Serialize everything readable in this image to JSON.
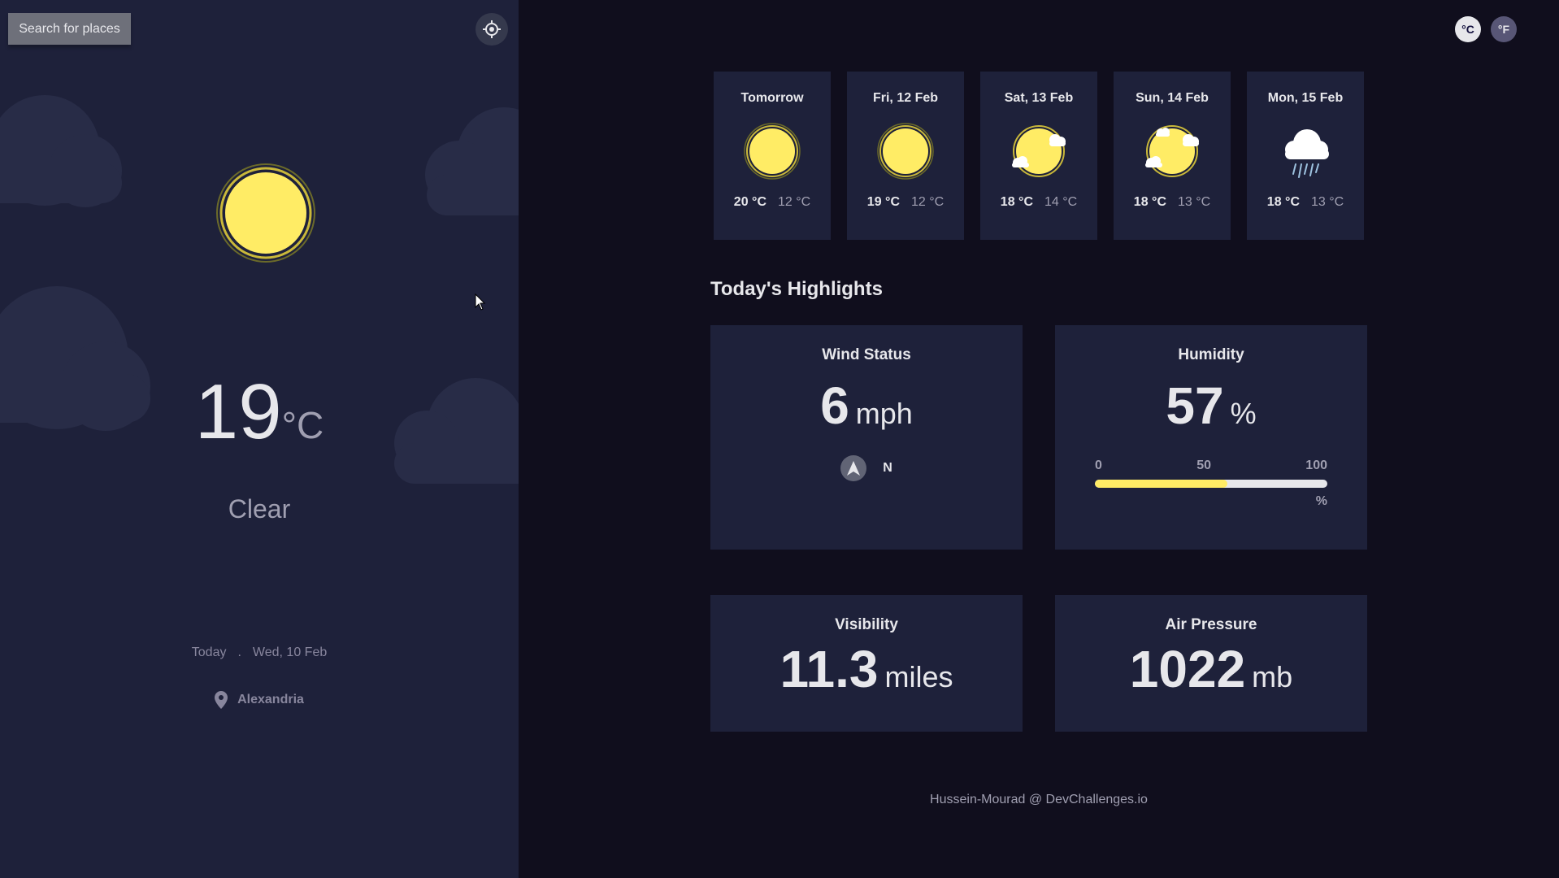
{
  "search": {
    "label": "Search for places"
  },
  "current": {
    "temp": "19",
    "unit": "°C",
    "condition": "Clear",
    "today_label": "Today",
    "separator": ".",
    "date": "Wed, 10 Feb",
    "location": "Alexandria",
    "icon": "sun-icon"
  },
  "units": {
    "celsius": "°C",
    "fahrenheit": "°F",
    "active": "celsius"
  },
  "forecast": [
    {
      "day": "Tomorrow",
      "max": "20 °C",
      "min": "12 °C",
      "icon": "sun-icon"
    },
    {
      "day": "Fri, 12 Feb",
      "max": "19 °C",
      "min": "12 °C",
      "icon": "sun-icon"
    },
    {
      "day": "Sat, 13 Feb",
      "max": "18 °C",
      "min": "14 °C",
      "icon": "sun-clouds-icon"
    },
    {
      "day": "Sun, 14 Feb",
      "max": "18 °C",
      "min": "13 °C",
      "icon": "sun-clouds-icon"
    },
    {
      "day": "Mon, 15 Feb",
      "max": "18 °C",
      "min": "13 °C",
      "icon": "rain-cloud-icon"
    }
  ],
  "highlights": {
    "title": "Today's Highlights",
    "wind": {
      "title": "Wind Status",
      "value": "6",
      "unit": "mph",
      "direction": "N"
    },
    "humidity": {
      "title": "Humidity",
      "value": "57",
      "unit": "%",
      "scale": [
        "0",
        "50",
        "100"
      ],
      "scale_unit": "%",
      "fill_percent": 57
    },
    "visibility": {
      "title": "Visibility",
      "value": "11.3",
      "unit": "miles"
    },
    "pressure": {
      "title": "Air Pressure",
      "value": "1022",
      "unit": "mb"
    }
  },
  "colors": {
    "sun": "#ffec65",
    "humidity_fill": "#ffec65",
    "sidebar_bg": "#1e213a",
    "main_bg": "#100e1d"
  },
  "footer": {
    "credit": "Hussein-Mourad @ DevChallenges.io"
  }
}
